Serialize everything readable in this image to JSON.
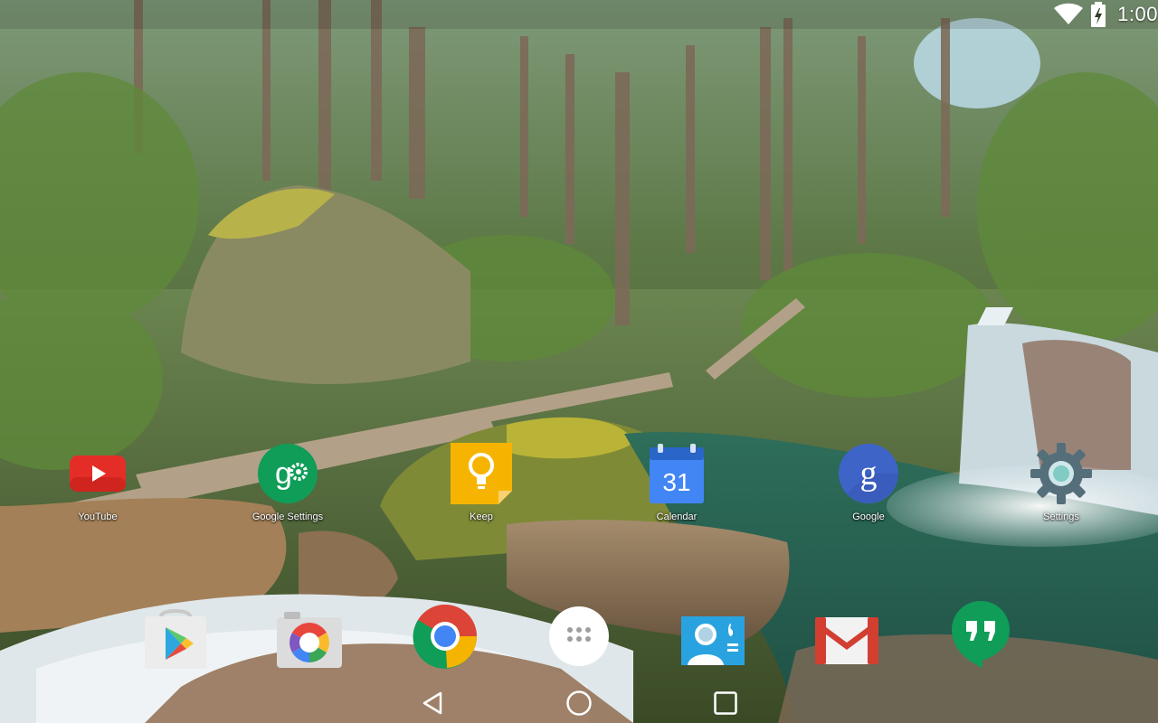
{
  "status_bar": {
    "time": "1:00",
    "icons": [
      "wifi-icon",
      "battery-charging-icon"
    ]
  },
  "workspace": {
    "apps": [
      {
        "label": "YouTube",
        "icon": "youtube-icon"
      },
      {
        "label": "Google Settings",
        "icon": "google-settings-icon"
      },
      {
        "label": "Keep",
        "icon": "keep-icon"
      },
      {
        "label": "Calendar",
        "icon": "calendar-icon",
        "badge": "31"
      },
      {
        "label": "Google",
        "icon": "google-icon",
        "badge": "g"
      },
      {
        "label": "Settings",
        "icon": "settings-icon"
      }
    ]
  },
  "hotseat": {
    "items": [
      "play-store-icon",
      "camera-icon",
      "chrome-icon",
      "all-apps-icon",
      "contacts-icon",
      "gmail-icon",
      "hangouts-icon"
    ]
  },
  "nav_bar": {
    "buttons": [
      "back-icon",
      "home-icon",
      "recents-icon"
    ]
  },
  "colors": {
    "youtube_red": "#e52d27",
    "google_green": "#0f9d58",
    "keep_yellow": "#f6b400",
    "calendar_blue": "#4285f4",
    "google_blue": "#3f64c8",
    "settings_gray": "#546e7a",
    "gmail_red": "#d23f31",
    "hangouts_green": "#0f9d58"
  }
}
